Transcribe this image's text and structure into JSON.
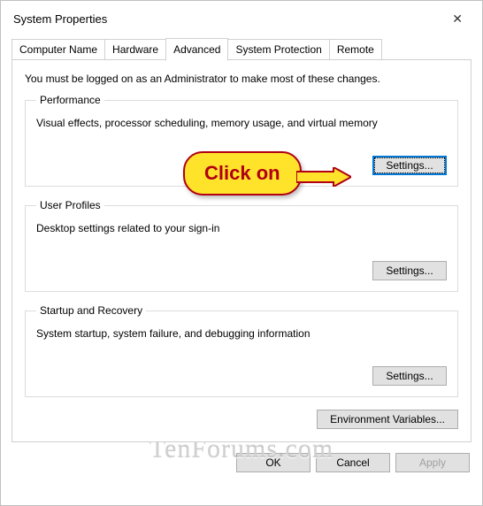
{
  "window": {
    "title": "System Properties"
  },
  "tabs": {
    "computer_name": "Computer Name",
    "hardware": "Hardware",
    "advanced": "Advanced",
    "system_protection": "System Protection",
    "remote": "Remote"
  },
  "intro": "You must be logged on as an Administrator to make most of these changes.",
  "performance": {
    "legend": "Performance",
    "desc": "Visual effects, processor scheduling, memory usage, and virtual memory",
    "button": "Settings..."
  },
  "user_profiles": {
    "legend": "User Profiles",
    "desc": "Desktop settings related to your sign-in",
    "button": "Settings..."
  },
  "startup": {
    "legend": "Startup and Recovery",
    "desc": "System startup, system failure, and debugging information",
    "button": "Settings..."
  },
  "env_button": "Environment Variables...",
  "buttons": {
    "ok": "OK",
    "cancel": "Cancel",
    "apply": "Apply"
  },
  "callout": "Click on",
  "watermark": "TenForums.com"
}
